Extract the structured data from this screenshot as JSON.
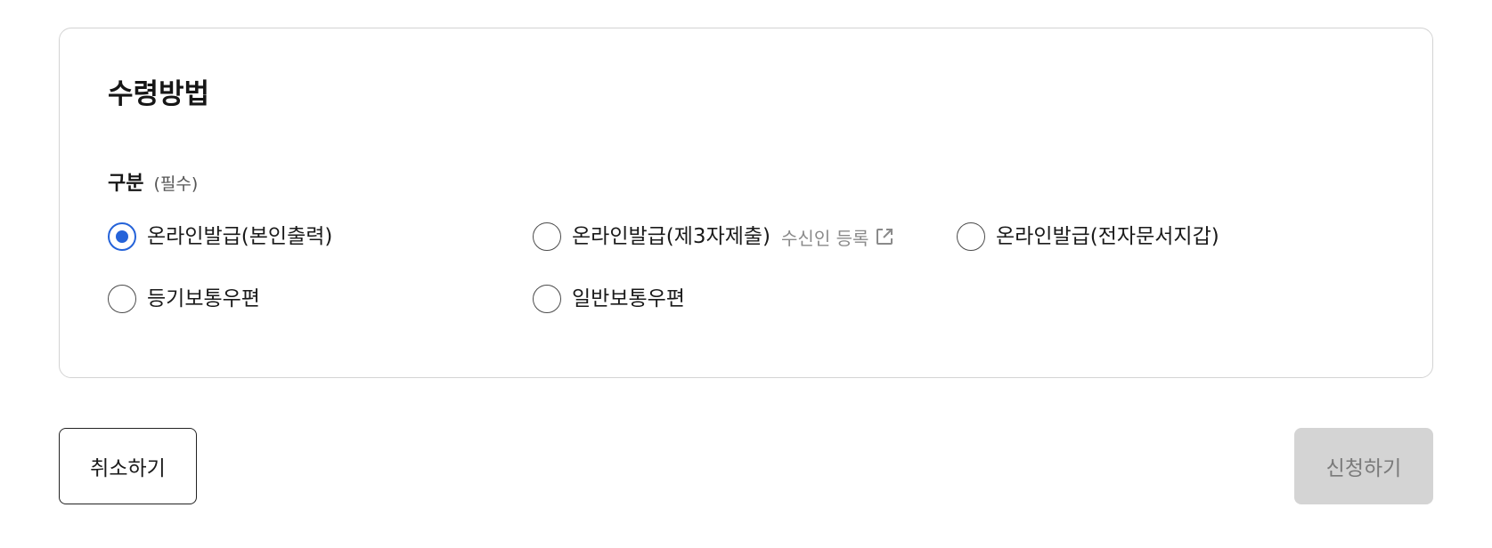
{
  "section": {
    "title": "수령방법"
  },
  "field": {
    "label": "구분",
    "required_text": "(필수)"
  },
  "options": [
    {
      "label": "온라인발급(본인출력)",
      "selected": true
    },
    {
      "label": "온라인발급(제3자제출)",
      "selected": false
    },
    {
      "label": "온라인발급(전자문서지갑)",
      "selected": false
    },
    {
      "label": "등기보통우편",
      "selected": false
    },
    {
      "label": "일반보통우편",
      "selected": false
    }
  ],
  "recipient_link": {
    "label": "수신인 등록",
    "icon": "external-link-icon"
  },
  "buttons": {
    "cancel": "취소하기",
    "submit": "신청하기"
  },
  "colors": {
    "accent": "#2563d9",
    "disabled_bg": "#d4d4d4",
    "disabled_text": "#7a7a7a",
    "muted_text": "#8a8a8a"
  }
}
